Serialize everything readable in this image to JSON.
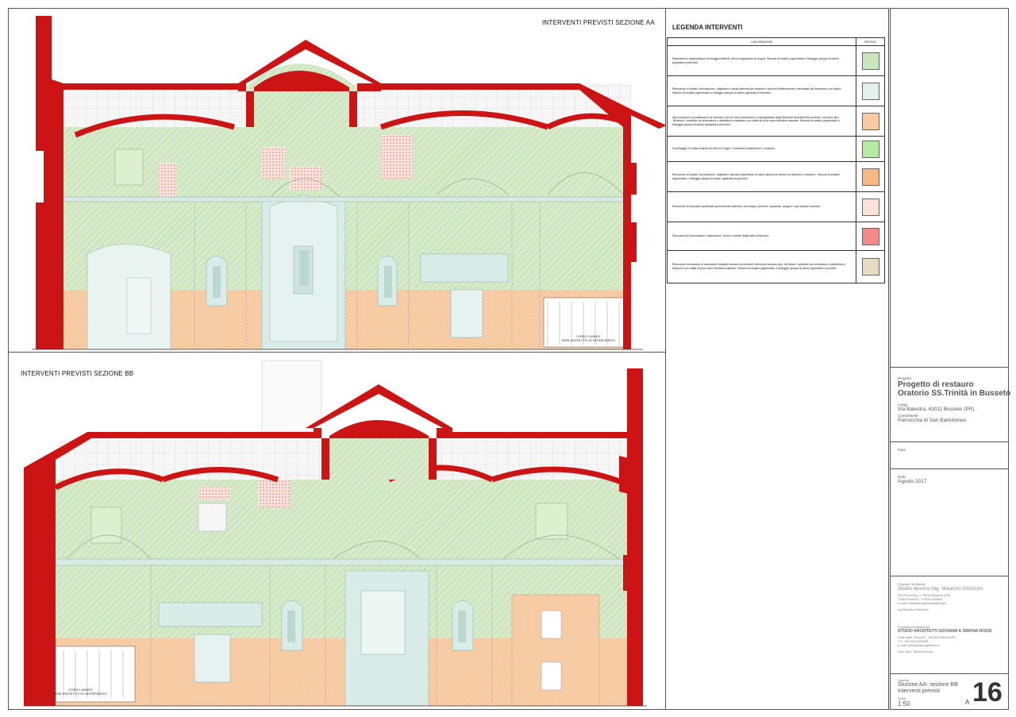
{
  "sections": {
    "aa_title": "INTERVENTI PREVISTI SEZIONE AA",
    "bb_title": "INTERVENTI PREVISTI SEZIONE BB",
    "aa_note_line1": "CORO LIGNEO",
    "aa_note_line2": "NON OGGETTO DI INTERVENTO",
    "bb_note_line1": "CORO LIGNEO",
    "bb_note_line2": "NON OGGETTO DI INTERVENTO"
  },
  "legend": {
    "title": "LEGENDA INTERVENTI",
    "col_work": "LAVORAZIONI",
    "col_retino": "RETINO",
    "rows": [
      {
        "text": "Rasciatura e spazzolatura di tinteggi esistenti, previa bagnatura ed acqua. Stesura di scialbo pigmentato o tinteggio (acqua di calce) applicata a pennello.",
        "color": "#c9e6bd"
      },
      {
        "text": "Rimozione di scialbi, incrostazioni, ridipinture e strati aderenti da velature e ritocchi effettivamente interessati dal fenomeno con bisturi. Stesura di scialbo pigmentato o tinteggio (acqua di calce) applicata a pennello.",
        "color": "#e3f0ec"
      },
      {
        "text": "Spicconatura e scrostamento di intonaco vivo di muro esecuzione e salvaguardia degli elementi architettonici presenti. Intonaco tipo \"all'antica\" costituito da arricciatura e stabilitura a frattazzo con malta di pura calce idraulica naturale. Stesura di scialbo pigmentato o tinteggio (acqua di calce) applicata a pennello.",
        "color": "#f9c9a0"
      },
      {
        "text": "Smontaggio di infissi esterni ed interni in legno. Eventuale sostituzione o restauro.",
        "color": "#b5ec9f"
      },
      {
        "text": "Rimozione di scialbi, incrostazioni, ridipinture depositi superficiali di varia natura con bisturi su affreschi e tempere. Stesura di scialbo pigmentato o tinteggio (acqua di calce) applicata a pennello.",
        "color": "#f6b985"
      },
      {
        "text": "Rimozione di depositi superficiali parzialmente aderenti, con acqua, pennelli, spazzole, spugne e spruzzatori manuali.",
        "color": "#fbe3dc"
      },
      {
        "text": "Stuccatura di fessurazioni, fratturazioni, bordi e cadute degli strati d'intonaco.",
        "color": "#f48a8a"
      },
      {
        "text": "Rimozione meccanica di stuccature eseguite durante precedenti interventi intonaco tipo \"all'antica\" costituito da arricciatura e stabilitura a frattazzo con malta di pura calce idraulica naturale. Stesura di scialbo pigmentato o tinteggio (acqua di calce) applicata a pennello.",
        "color": "#e8dcc0"
      }
    ]
  },
  "titleblock": {
    "progetto_label": "Progetto",
    "progetto_line1": "Progetto di restauro",
    "progetto_line2": "Oratorio SS.Trinità in Busseto",
    "luogo_label": "Luogo",
    "luogo": "Via Balestra, 43011 Busseto (PR)",
    "committente_label": "Committente",
    "committente": "Parrocchia di San Bartolomeo",
    "fase_label": "Fase",
    "data_label": "Data",
    "data": "Agosto 2017",
    "strutturale_label": "Progetto Strutturale",
    "strutturale_name": "Studio tecnico Ing. Maurizio Ghizzoni",
    "strutturale_addr1": "Via Ferrucheri, 2 43011 Busseto (PR)",
    "strutturale_addr2": "T.0524 930103 - F.0524 930540",
    "strutturale_addr3": "e-mail: maurizio.ghizzoni@pleng.it",
    "strutturale_sign": "Ing.Maurizio Ghizzoni",
    "arch_label": "Progetto architettonico",
    "arch_name": "STUDIO ARCHITETTI GIOVANNI E SIMONA ROSSI",
    "arch_addr1": "Viale della Vittoria 6 - 43036 Fidenza (Pr)",
    "arch_addr2": "T-F +39 0524 526296",
    "arch_addr3": "e-mail: studiorossi.g@libero.it",
    "arch_sign": "Dott. Arch. Simona Rossi",
    "oggetto_label": "Oggetto",
    "oggetto_line1": "Sezione AA- sezione BB",
    "oggetto_line2": "Interventi previsti",
    "scala_label": "Scala",
    "scala": "1:50",
    "formato": "A",
    "tavola": "16"
  },
  "colors": {
    "wall_red": "#cc1414",
    "green_hatch": "#c9e6bd",
    "orange_hatch": "#f9c9a0",
    "light_cyan": "#dcefea",
    "pink_dots": "#f4a3a3",
    "line": "#8a8a8a"
  }
}
